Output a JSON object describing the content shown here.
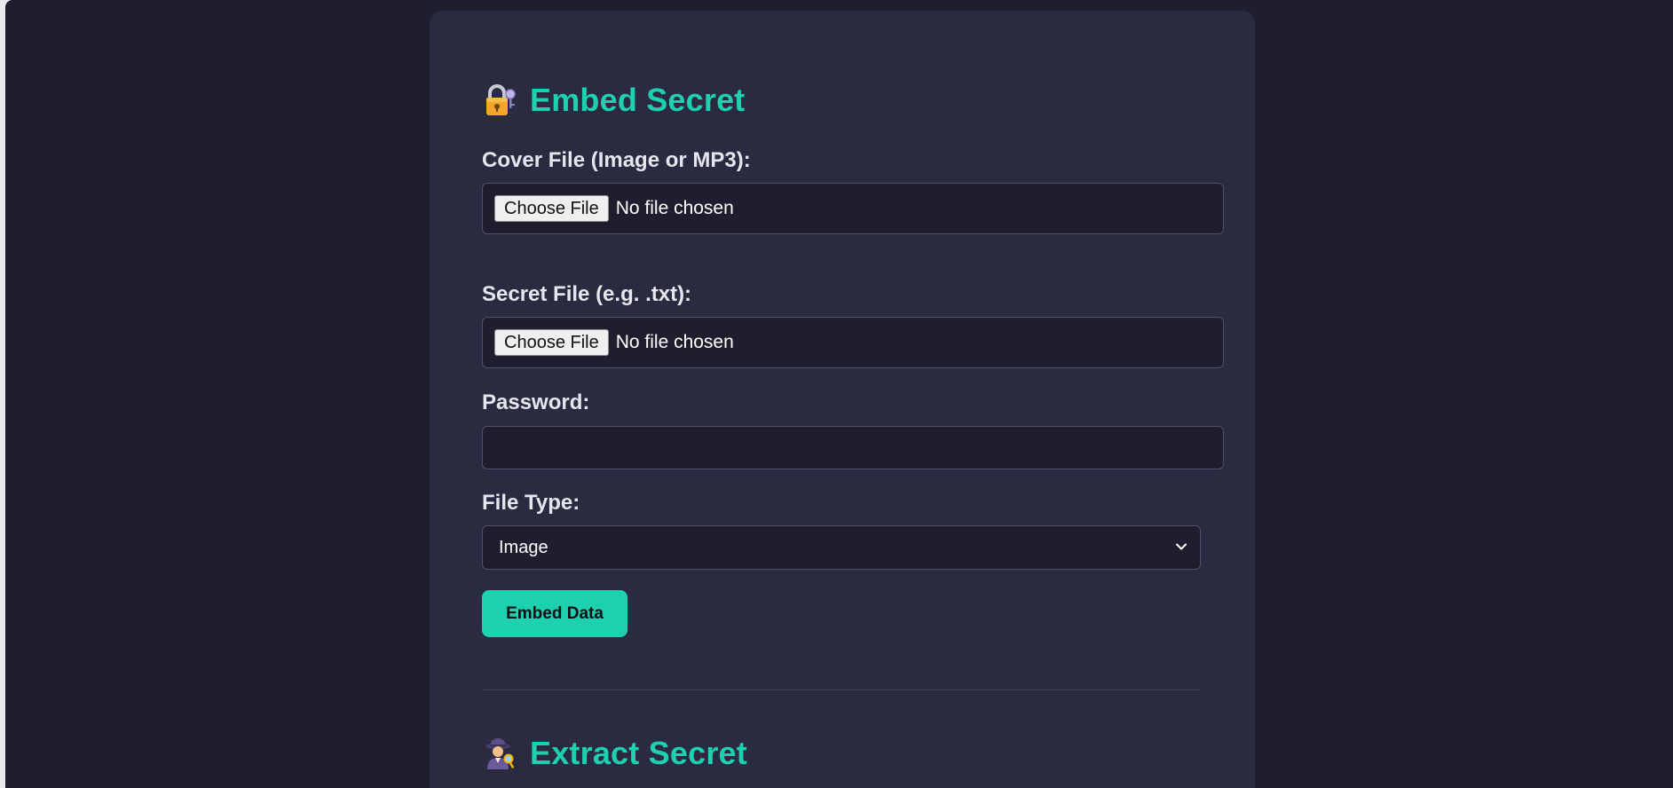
{
  "embed": {
    "title": "Embed Secret",
    "title_icon": "locked-with-key-icon",
    "cover_label": "Cover File (Image or MP3):",
    "cover_button": "Choose File",
    "cover_status": "No file chosen",
    "secret_label": "Secret File (e.g. .txt):",
    "secret_button": "Choose File",
    "secret_status": "No file chosen",
    "password_label": "Password:",
    "password_value": "",
    "filetype_label": "File Type:",
    "filetype_selected": "Image",
    "submit_label": "Embed Data"
  },
  "extract": {
    "title": "Extract Secret",
    "title_icon": "detective-icon"
  },
  "colors": {
    "accent": "#1dd1ae",
    "page_bg": "#1f1e2e",
    "card_bg": "#2a2a40"
  }
}
